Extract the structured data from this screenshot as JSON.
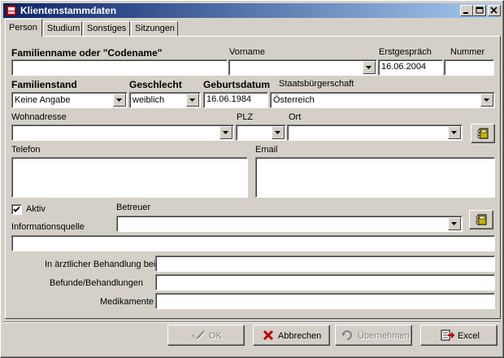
{
  "window": {
    "title": "Klientenstammdaten",
    "min_icon": "minimize-icon",
    "max_icon": "maximize-icon",
    "close_icon": "close-icon"
  },
  "tabs": [
    {
      "label": "Person",
      "active": true
    },
    {
      "label": "Studium",
      "active": false
    },
    {
      "label": "Sonstiges",
      "active": false
    },
    {
      "label": "Sitzungen",
      "active": false
    }
  ],
  "form": {
    "familienname_label": "Familienname oder \"Codename\"",
    "familienname_value": "",
    "vorname_label": "Vorname",
    "vorname_value": "",
    "erstgespraech_label": "Erstgespräch",
    "erstgespraech_value": "16.06.2004",
    "nummer_label": "Nummer",
    "nummer_value": "",
    "familienstand_label": "Familienstand",
    "familienstand_value": "Keine Angabe",
    "geschlecht_label": "Geschlecht",
    "geschlecht_value": "weiblich",
    "geburtsdatum_label": "Geburtsdatum",
    "geburtsdatum_value": "16.06.1984",
    "staatsbuergerschaft_label": "Staatsbürgerschaft",
    "staatsbuergerschaft_value": "Österreich",
    "wohnadresse_label": "Wohnadresse",
    "wohnadresse_value": "",
    "plz_label": "PLZ",
    "plz_value": "",
    "ort_label": "Ort",
    "ort_value": "",
    "telefon_label": "Telefon",
    "telefon_value": "",
    "email_label": "Email",
    "email_value": "",
    "aktiv_label": "Aktiv",
    "aktiv_checked": true,
    "betreuer_label": "Betreuer",
    "betreuer_value": "",
    "informationsquelle_label": "Informationsquelle",
    "informationsquelle_value": "",
    "aerztliche_label": "In ärztlicher Behandlung bei",
    "aerztliche_value": "",
    "befunde_label": "Befunde/Behandlungen",
    "befunde_value": "",
    "medikamente_label": "Medikamente",
    "medikamente_value": ""
  },
  "buttons": {
    "ok": "OK",
    "abbrechen": "Abbrechen",
    "uebernehmen": "Übernehmen",
    "excel": "Excel"
  },
  "colors": {
    "title_start": "#0a246a",
    "title_end": "#a6caf0",
    "face": "#d4d0c8"
  }
}
